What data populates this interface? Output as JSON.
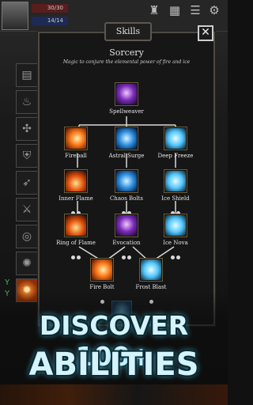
{
  "hud": {
    "hp_text": "30/30",
    "mp_text": "14/14"
  },
  "side_icons": [
    {
      "icon": "book-icon"
    },
    {
      "icon": "cauldron-icon"
    },
    {
      "icon": "rune-icon"
    },
    {
      "icon": "shield-icon"
    },
    {
      "icon": "bow-icon"
    },
    {
      "icon": "claw-icon"
    },
    {
      "icon": "vortex-icon"
    },
    {
      "icon": "glyph-icon"
    },
    {
      "icon": "fireball-icon"
    }
  ],
  "modal": {
    "tab_label": "Skills",
    "close_glyph": "✕",
    "title": "Sorcery",
    "subtitle": "Magic to conjure the elemental power of fire and ice"
  },
  "skills": {
    "spellweaver": {
      "name": "Spellweaver",
      "dots": 1
    },
    "fireball": {
      "name": "Fireball",
      "dots": 1
    },
    "astral_surge": {
      "name": "Astral Surge",
      "dots": 1
    },
    "deep_freeze": {
      "name": "Deep Freeze",
      "dots": 1
    },
    "inner_flame": {
      "name": "Inner Flame",
      "dots": 2
    },
    "chaos_bolts": {
      "name": "Chaos Bolts",
      "dots": 2
    },
    "ice_shield": {
      "name": "Ice Shield",
      "dots": 2
    },
    "ring_of_flame": {
      "name": "Ring of Flame",
      "dots": 2
    },
    "evocation": {
      "name": "Evocation",
      "dots": 2
    },
    "ice_nova": {
      "name": "Ice Nova",
      "dots": 2
    },
    "fire_bolt": {
      "name": "Fire Bolt",
      "dots": 1
    },
    "frost_blast": {
      "name": "Frost Blast",
      "dots": 1
    }
  },
  "promo": {
    "line1": "DISCOVER 100+",
    "line2": "ABILITIES"
  },
  "colors": {
    "accent_text": "#d4f3fb",
    "green_log": "#4caf50"
  }
}
